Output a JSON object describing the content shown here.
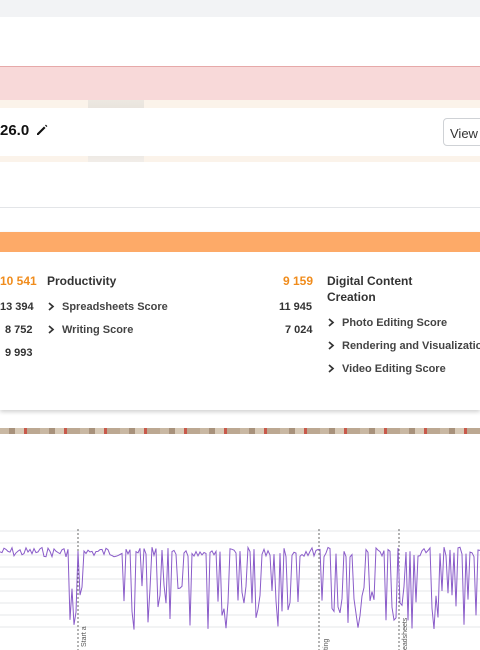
{
  "result": {
    "title": "26.0",
    "view_button": "View r"
  },
  "scores": {
    "col1": {
      "main": "10 541",
      "items": [
        "13 394",
        "8 752",
        "9 993"
      ]
    },
    "productivity": {
      "label": "Productivity",
      "score": "9 159",
      "items": [
        {
          "label": "Spreadsheets Score",
          "value": "11 945"
        },
        {
          "label": "Writing Score",
          "value": "7 024"
        }
      ]
    },
    "digital_content": {
      "label_line1": "Digital Content",
      "label_line2": "Creation",
      "items": [
        {
          "label": "Photo Editing Score"
        },
        {
          "label": "Rendering and Visualization S"
        },
        {
          "label": "Video Editing Score"
        }
      ]
    }
  },
  "chart_markers": [
    "Start a",
    "ting",
    "eadsheets"
  ],
  "colors": {
    "accent_orange": "#fdaa68",
    "score_orange": "#f08c1c",
    "series": "#8a5cc9",
    "alert": "#f8d9d9"
  }
}
